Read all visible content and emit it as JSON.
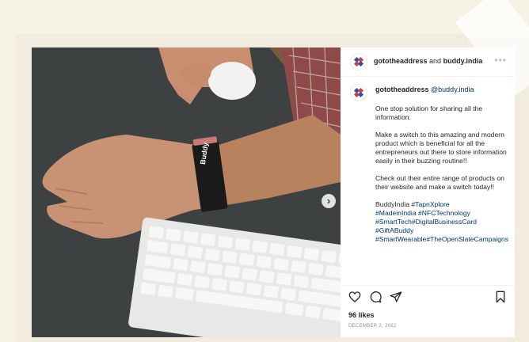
{
  "post": {
    "author": "gototheaddress",
    "joiner": "and",
    "collaborator": "buddy.india",
    "more_icon": "more-dots-icon",
    "caption_author": "gototheaddress",
    "caption_mention": "@buddy.india",
    "caption_paragraphs": [
      "One stop solution for sharing all the information.",
      "Make a switch to this amazing and modern product which is beneficial for all the entrepreneurs out there to store information easily in their buzzing routine!!",
      "Check out their entire range of products on their website and make a switch today!!"
    ],
    "caption_brand": "BuddyIndia",
    "hashtags": [
      "#TapnXplore",
      "#MadeinIndia",
      "#NFCTechnology",
      "#SmartTech",
      "#DigitalBusinessCard",
      "#GiftABuddy",
      "#SmartWearable",
      "#TheOpenSlateCampaigns"
    ],
    "likes": "96 likes",
    "date": "DECEMBER 2, 2022"
  },
  "image": {
    "band_text": "Buddy",
    "next_label": "›"
  },
  "actions": {
    "like_icon": "heart-icon",
    "comment_icon": "comment-icon",
    "share_icon": "share-icon",
    "save_icon": "bookmark-icon"
  },
  "colors": {
    "background": "#f7f2e6",
    "link": "#00376b",
    "text": "#262626",
    "muted": "#8e8e8e"
  }
}
